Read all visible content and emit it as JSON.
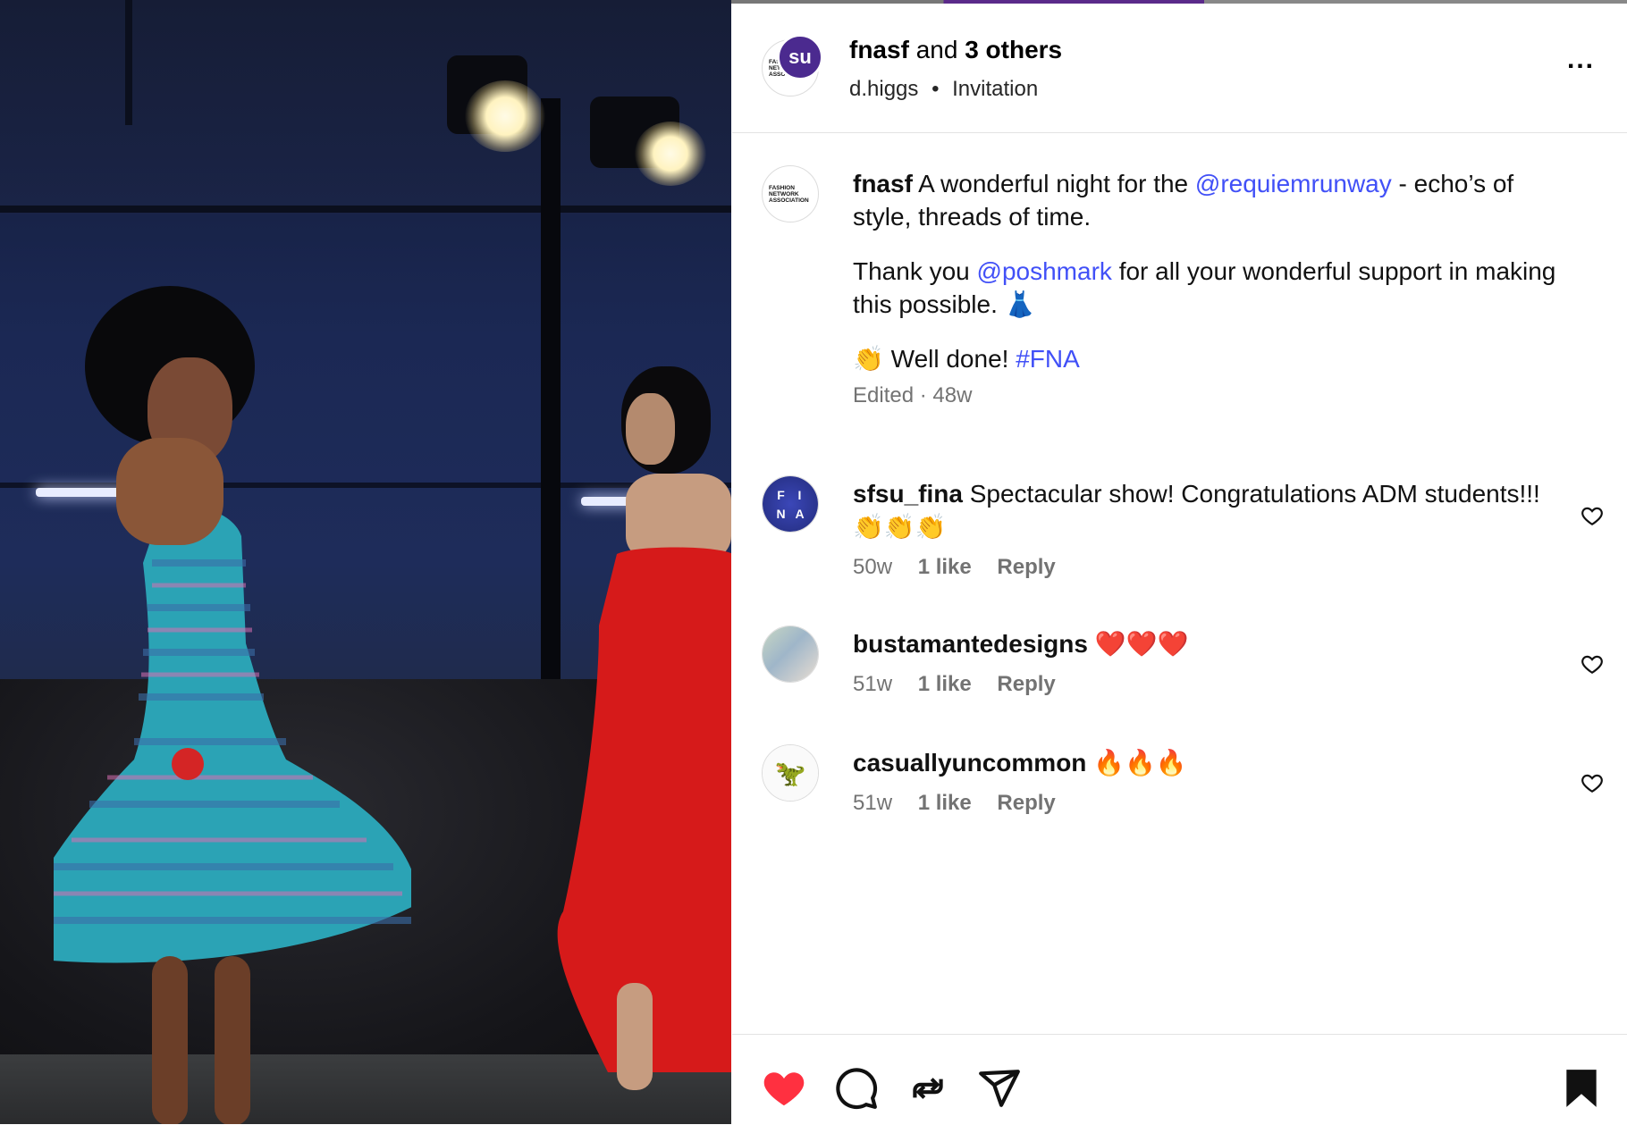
{
  "header": {
    "author": "fnasf",
    "and_text": "and",
    "others": "3 others",
    "subline_user": "d.higgs",
    "separator": "•",
    "subline_tag": "Invitation",
    "more_label": "...",
    "avatar_badge": "su"
  },
  "caption": {
    "username": "fnasf",
    "p1_before": "A wonderful night for the",
    "p1_mention": "@requiemrunway",
    "p1_after": "- echo’s of style, threads of time.",
    "p2_before": "Thank you",
    "p2_mention": "@poshmark",
    "p2_after": "for all your wonderful support in making this possible. 👗",
    "p3_before": "👏 Well done!",
    "p3_hashtag": "#FNA",
    "meta": "Edited · 48w"
  },
  "logo_text": {
    "fna_line1": "FASHION",
    "fna_line2": "NETWORK",
    "fna_line3": "ASSOCIATION",
    "fina": [
      "F",
      "I",
      "N",
      "A"
    ]
  },
  "comments": [
    {
      "username": "sfsu_fina",
      "text": "Spectacular show! Congratulations ADM students!!! 👏👏👏",
      "age": "50w",
      "likes": "1 like",
      "reply": "Reply"
    },
    {
      "username": "bustamantedesigns",
      "text": "❤️❤️❤️",
      "age": "51w",
      "likes": "1 like",
      "reply": "Reply"
    },
    {
      "username": "casuallyuncommon",
      "text": "🔥🔥🔥",
      "age": "51w",
      "likes": "1 like",
      "reply": "Reply"
    }
  ],
  "colors": {
    "mention": "#4150f7",
    "like_active": "#ff3040",
    "muted": "#737373"
  },
  "icons": [
    "heart-filled-icon",
    "comment-icon",
    "repost-icon",
    "share-icon",
    "bookmark-filled-icon",
    "heart-outline-icon",
    "more-icon"
  ]
}
